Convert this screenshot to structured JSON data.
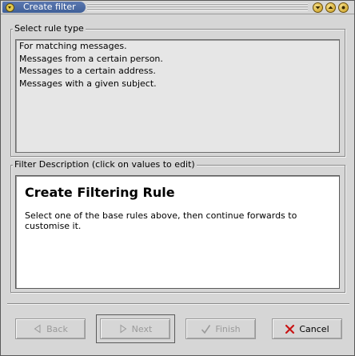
{
  "window": {
    "title": "Create filter",
    "controls": [
      "minimize-icon",
      "maximize-icon",
      "close-icon"
    ]
  },
  "rule_type": {
    "label": "Select rule type",
    "items": [
      "For matching messages.",
      "Messages from a certain person.",
      "Messages to a certain address.",
      "Messages with a given subject."
    ]
  },
  "description": {
    "label": "Filter Description (click on values to edit)",
    "heading": "Create Filtering Rule",
    "body": "Select one of the base rules above, then continue forwards to customise it."
  },
  "buttons": {
    "back": "Back",
    "next": "Next",
    "finish": "Finish",
    "cancel": "Cancel"
  },
  "colors": {
    "title_accent": "#4a6aa5",
    "cancel_icon": "#c81414"
  }
}
